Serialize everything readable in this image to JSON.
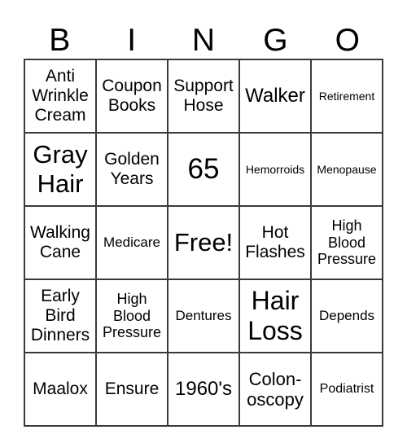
{
  "header": {
    "letters": [
      "B",
      "I",
      "N",
      "G",
      "O"
    ]
  },
  "grid": {
    "rows": [
      [
        {
          "text": "Anti Wrinkle Cream",
          "lines": [
            "Anti",
            "Wrinkle",
            "Cream"
          ]
        },
        {
          "text": "Coupon Books",
          "lines": [
            "Coupon",
            "Books"
          ]
        },
        {
          "text": "Support Hose",
          "lines": [
            "Support",
            "Hose"
          ]
        },
        {
          "text": "Walker",
          "lines": [
            "Walker"
          ]
        },
        {
          "text": "Retirement",
          "lines": [
            "Retirement"
          ]
        }
      ],
      [
        {
          "text": "Gray Hair",
          "lines": [
            "Gray",
            "Hair"
          ]
        },
        {
          "text": "Golden Years",
          "lines": [
            "Golden",
            "Years"
          ]
        },
        {
          "text": "65",
          "lines": [
            "65"
          ]
        },
        {
          "text": "Hemorroids",
          "lines": [
            "Hemorroids"
          ]
        },
        {
          "text": "Menopause",
          "lines": [
            "Menopause"
          ]
        }
      ],
      [
        {
          "text": "Walking Cane",
          "lines": [
            "Walking",
            "Cane"
          ]
        },
        {
          "text": "Medicare",
          "lines": [
            "Medicare"
          ]
        },
        {
          "text": "Free!",
          "lines": [
            "Free!"
          ]
        },
        {
          "text": "Hot Flashes",
          "lines": [
            "Hot",
            "Flashes"
          ]
        },
        {
          "text": "High Blood Pressure",
          "lines": [
            "High",
            "Blood",
            "Pressure"
          ]
        }
      ],
      [
        {
          "text": "Early Bird Dinners",
          "lines": [
            "Early",
            "Bird",
            "Dinners"
          ]
        },
        {
          "text": "High Blood Pressure",
          "lines": [
            "High",
            "Blood",
            "Pressure"
          ]
        },
        {
          "text": "Dentures",
          "lines": [
            "Dentures"
          ]
        },
        {
          "text": "Hair Loss",
          "lines": [
            "Hair",
            "Loss"
          ]
        },
        {
          "text": "Depends",
          "lines": [
            "Depends"
          ]
        }
      ],
      [
        {
          "text": "Maalox",
          "lines": [
            "Maalox"
          ]
        },
        {
          "text": "Ensure",
          "lines": [
            "Ensure"
          ]
        },
        {
          "text": "1960's",
          "lines": [
            "1960's"
          ]
        },
        {
          "text": "Colon-oscopy",
          "lines": [
            "Colon-",
            "oscopy"
          ]
        },
        {
          "text": "Podiatrist",
          "lines": [
            "Podiatrist"
          ]
        }
      ]
    ]
  }
}
